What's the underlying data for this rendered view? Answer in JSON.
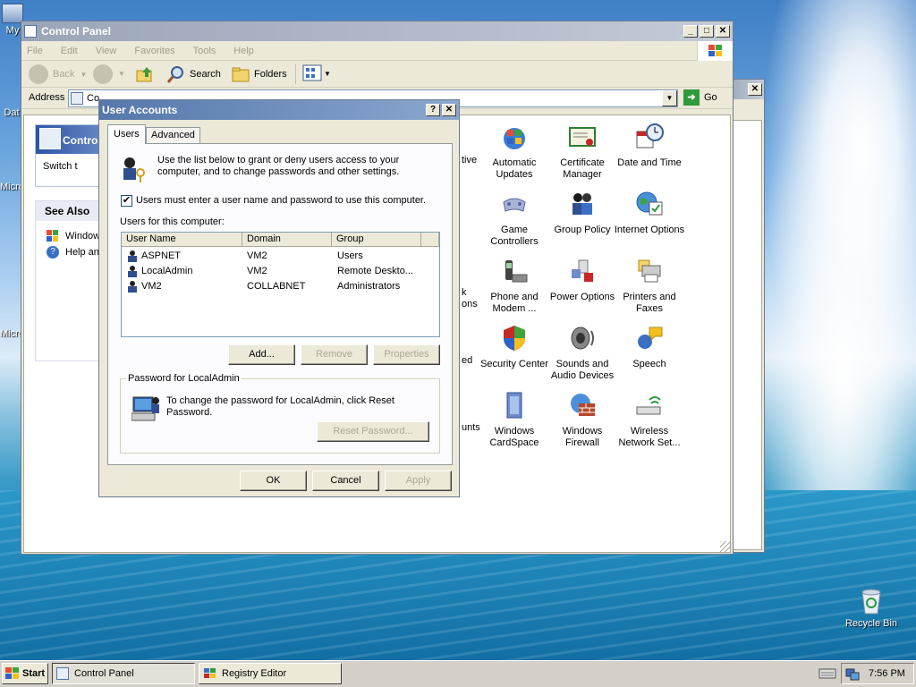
{
  "desktop": {
    "icons_left": [
      "My",
      "Dat",
      "Micro",
      "Micro"
    ],
    "recycle_bin": "Recycle Bin"
  },
  "control_panel": {
    "title": "Control Panel",
    "menu": [
      "File",
      "Edit",
      "View",
      "Favorites",
      "Tools",
      "Help"
    ],
    "toolbar": {
      "back": "Back",
      "search": "Search",
      "folders": "Folders"
    },
    "address_label": "Address",
    "address_value": "Co",
    "go": "Go",
    "sidebar": {
      "panel_title": "Contro",
      "switch": "Switch t",
      "see_also": "See Also",
      "links": [
        "Window",
        "Help an"
      ]
    },
    "items": [
      {
        "label": "Automatic Updates",
        "icon": "automatic-updates-icon"
      },
      {
        "label": "Certificate Manager",
        "icon": "certificate-manager-icon"
      },
      {
        "label": "Date and Time",
        "icon": "date-time-icon"
      },
      {
        "label": "Game Controllers",
        "icon": "game-controllers-icon"
      },
      {
        "label": "Group Policy",
        "icon": "group-policy-icon"
      },
      {
        "label": "Internet Options",
        "icon": "internet-options-icon"
      },
      {
        "label": "Phone and Modem ...",
        "icon": "phone-modem-icon"
      },
      {
        "label": "Power Options",
        "icon": "power-options-icon"
      },
      {
        "label": "Printers and Faxes",
        "icon": "printers-faxes-icon"
      },
      {
        "label": "Security Center",
        "icon": "security-center-icon"
      },
      {
        "label": "Sounds and Audio Devices",
        "icon": "sounds-icon"
      },
      {
        "label": "Speech",
        "icon": "speech-icon"
      },
      {
        "label": "Windows CardSpace",
        "icon": "cardspace-icon"
      },
      {
        "label": "Windows Firewall",
        "icon": "firewall-icon"
      },
      {
        "label": "Wireless Network Set...",
        "icon": "wireless-icon"
      }
    ],
    "partial_labels": [
      "tive",
      "k",
      "ons",
      "ed",
      "unts"
    ]
  },
  "dialog": {
    "title": "User Accounts",
    "tabs": [
      "Users",
      "Advanced"
    ],
    "intro": "Use the list below to grant or deny users access to your computer, and to change passwords and other settings.",
    "checkbox_label": "Users must enter a user name and password to use this computer.",
    "users_label": "Users for this computer:",
    "columns": [
      "User Name",
      "Domain",
      "Group"
    ],
    "users": [
      {
        "name": "ASPNET",
        "domain": "VM2",
        "group": "Users"
      },
      {
        "name": "LocalAdmin",
        "domain": "VM2",
        "group": "Remote Deskto..."
      },
      {
        "name": "VM2",
        "domain": "COLLABNET",
        "group": "Administrators"
      }
    ],
    "buttons": {
      "add": "Add...",
      "remove": "Remove",
      "properties": "Properties"
    },
    "password_group": "Password for LocalAdmin",
    "password_text": "To change the password for LocalAdmin, click Reset Password.",
    "reset_password": "Reset Password...",
    "ok": "OK",
    "cancel": "Cancel",
    "apply": "Apply"
  },
  "taskbar": {
    "start": "Start",
    "tasks": [
      "Control Panel",
      "Registry Editor"
    ],
    "clock": "7:56 PM"
  }
}
